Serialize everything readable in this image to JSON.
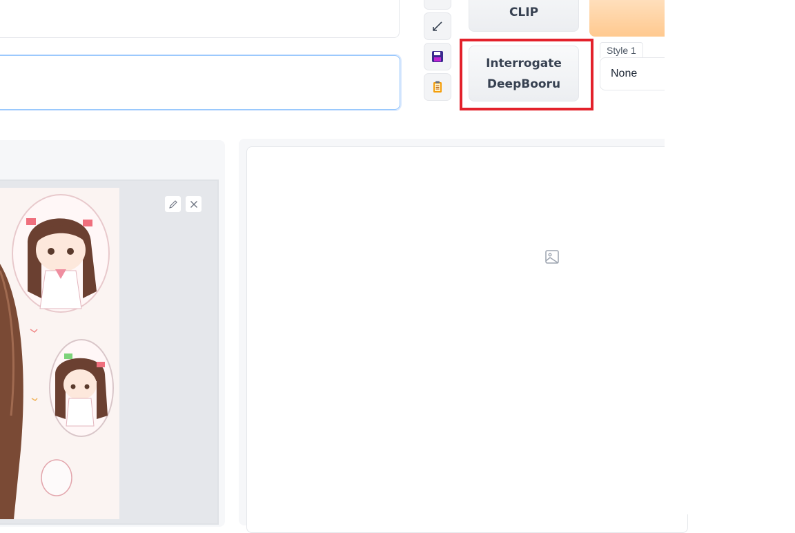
{
  "toolbar": {
    "clip_button_label": "CLIP",
    "deepbooru_line1": "Interrogate",
    "deepbooru_line2": "DeepBooru"
  },
  "styles": {
    "label": "Style 1",
    "selected": "None"
  },
  "icons": {
    "edit": "pencil-icon",
    "clear": "close-icon",
    "save": "floppy-disk-icon",
    "clipboard": "clipboard-icon",
    "pen": "line-pen-icon",
    "image_placeholder": "image-icon"
  },
  "colors": {
    "highlight": "#e3212b",
    "generate_gradient_top": "#ffe7cc",
    "generate_gradient_bottom": "#ffc98f"
  }
}
